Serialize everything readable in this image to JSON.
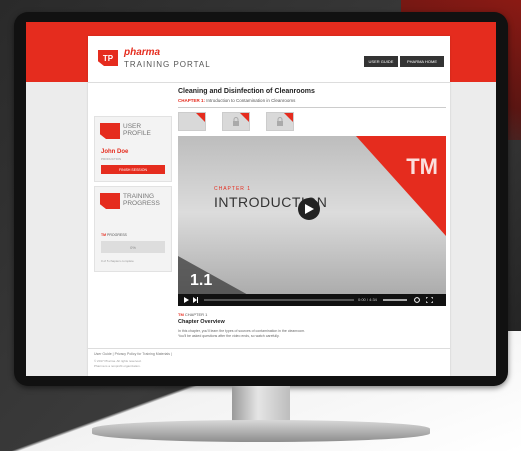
{
  "header": {
    "logo_mark": "TP",
    "brand": "pharma",
    "portal_title": "TRAINING PORTAL",
    "nav": [
      "USER GUIDE",
      "PHARMA HOME"
    ]
  },
  "user_profile": {
    "title_line1": "USER",
    "title_line2": "PROFILE",
    "name": "John Doe",
    "role": "PRODUCTION",
    "finish_button": "FINISH SESSION"
  },
  "training_progress": {
    "title_line1": "TRAINING",
    "title_line2": "PROGRESS",
    "label_tm": "TM",
    "label": "PROGRESS",
    "progress_value": "0%",
    "note": "0 of 5 chapters complete"
  },
  "course": {
    "title": "Cleaning and Disinfection of Cleanrooms",
    "chapter_prefix": "CHAPTER 1:",
    "chapter_name": "Introduction to Contamination in Cleanrooms"
  },
  "video": {
    "tm": "TM",
    "chapter_label": "CHAPTER 1",
    "title": "INTRODUCTION",
    "number": "1.1",
    "time": "0:00 / 4:34"
  },
  "chapter_info": {
    "label_tm": "TM",
    "label": "CHAPTER 1",
    "heading": "Chapter Overview",
    "line1": "In this chapter, you'll learn the types of sources of contamination in the cleanroom.",
    "line2": "You'll be asked questions after the video ends, so watch carefully."
  },
  "footer": {
    "link1": "User Guide",
    "link2": "Privacy Policy for Training Materials",
    "copy1": "© 2017 Pharma. All rights reserved.",
    "copy2": "Pharma is a nonprofit organization."
  },
  "colors": {
    "accent": "#e52c1e",
    "dark": "#333333"
  }
}
